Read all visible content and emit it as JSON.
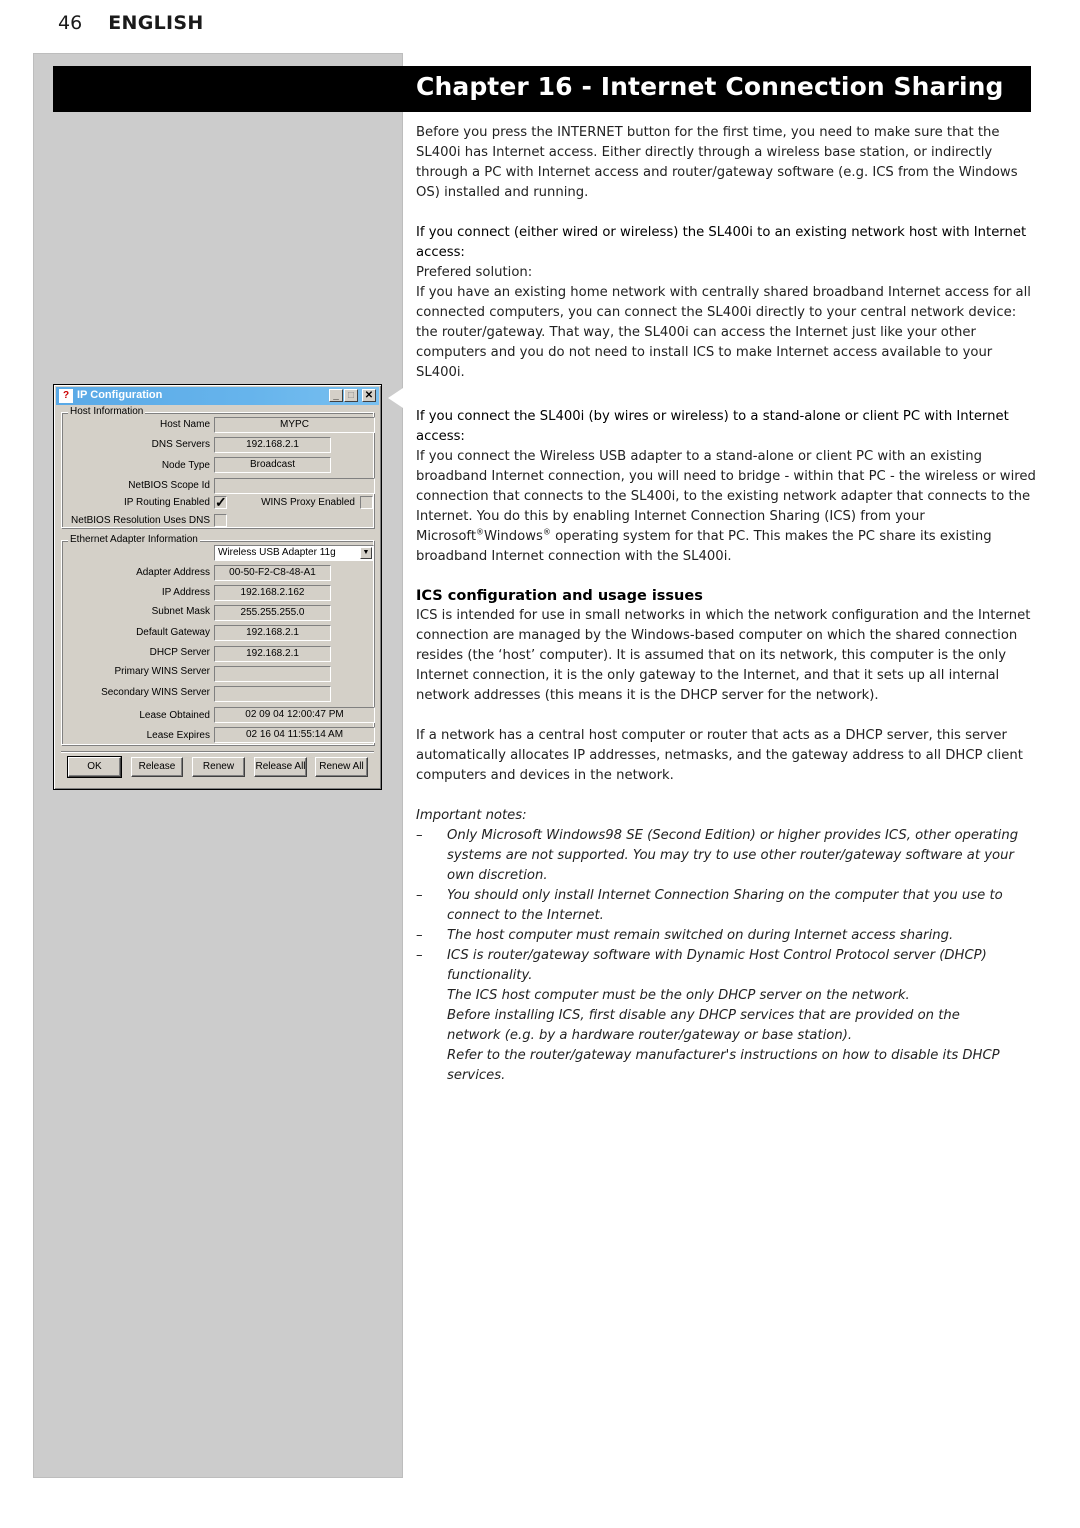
{
  "header": {
    "page_number": "46",
    "language": "ENGLISH"
  },
  "chapter": {
    "title": "Chapter 16 - Internet Connection Sharing"
  },
  "content": {
    "intro": "Before you press the INTERNET button for the first time, you need to make sure that the SL400i has Internet access. Either directly through a wireless base station, or indirectly through a PC with Internet access and router/gateway software (e.g. ICS from the Windows OS) installed and running.",
    "section1": {
      "lead": "If you connect (either wired or wireless) the SL400i to an existing network host with Internet access:",
      "subhead": "Prefered solution:",
      "body": "If you have an existing home network with centrally shared broadband Internet access for all connected computers, you can connect the SL400i directly to your central network device: the router/gateway. That way, the SL400i can access the Internet just like your other computers and you do not need to install ICS to make Internet access available to your SL400i."
    },
    "section2": {
      "lead": "If you connect the SL400i (by wires or wireless) to a stand-alone or client PC with Internet access:",
      "body_part1": "If you connect the Wireless USB adapter to a stand-alone or client PC with an existing broadband Internet connection, you will need to bridge - within that PC - the wireless or wired connection that connects to the SL400i, to the existing network adapter that connects to the Internet. You do this by enabling Internet Connection Sharing (ICS) from your Microsoft",
      "reg1": "®",
      "body_part2": "Windows",
      "reg2": "®",
      "body_part3": " operating system for that PC. This makes the PC share its existing broadband Internet connection with the SL400i."
    },
    "section3": {
      "heading": "ICS configuration and usage issues",
      "body1": "ICS is intended for use in small networks in which the network configuration and the Internet connection are managed by the Windows-based computer on which the shared connection resides (the ‘host’ computer). It is assumed that on its network, this computer is the only Internet connection, it is the only gateway to the Internet, and that it sets up all internal network addresses (this means it is the DHCP server for the network).",
      "body2": "If a network has a central host computer or router that acts as a DHCP server, this server automatically allocates IP addresses, netmasks, and the gateway address to all DHCP client computers and devices in the network."
    },
    "notes": {
      "title": "Important notes:",
      "dash": "–",
      "items": [
        "Only Microsoft Windows98 SE (Second Edition) or higher provides ICS, other operating systems are not supported. You may try to use other router/gateway software at your own discretion.",
        "You should only install Internet Connection Sharing on the computer that you use to connect to the Internet.",
        "The host computer must remain switched on during Internet access sharing.",
        "ICS is router/gateway software with Dynamic Host Control Protocol server (DHCP) functionality."
      ],
      "continuation": [
        "The ICS host computer must be the only DHCP server on the network.",
        "Before installing ICS, first disable any DHCP services that are provided on the network (e.g. by a hardware router/gateway or base station).",
        "Refer to the router/gateway manufacturer's instructions on how to disable its DHCP services."
      ]
    }
  },
  "dialog": {
    "title": "IP Configuration",
    "icon": "ip-config-app-icon",
    "controls": {
      "minimize": "_",
      "maximize": "□",
      "close": "✕"
    },
    "host_group": {
      "label": "Host Information",
      "host_name_label": "Host Name",
      "host_name": "MYPC",
      "dns_label": "DNS Servers",
      "dns": "192.168.2.1",
      "node_type_label": "Node Type",
      "node_type": "Broadcast",
      "scope_label": "NetBIOS Scope Id",
      "scope": "",
      "ip_routing_label": "IP Routing Enabled",
      "ip_routing_checked": true,
      "check_glyph": "✓",
      "wins_proxy_label": "WINS Proxy Enabled",
      "wins_proxy_checked": false,
      "netbios_dns_label": "NetBIOS Resolution Uses DNS",
      "netbios_dns_checked": false
    },
    "eth_group": {
      "label": "Ethernet  Adapter Information",
      "adapter_selected": "Wireless USB Adapter 11g",
      "dropdown_arrow": "▼",
      "adapter_address_label": "Adapter Address",
      "adapter_address": "00-50-F2-C8-48-A1",
      "ip_label": "IP Address",
      "ip": "192.168.2.162",
      "subnet_label": "Subnet Mask",
      "subnet": "255.255.255.0",
      "gateway_label": "Default Gateway",
      "gateway": "192.168.2.1",
      "dhcp_label": "DHCP Server",
      "dhcp": "192.168.2.1",
      "primary_wins_label": "Primary WINS Server",
      "primary_wins": "",
      "secondary_wins_label": "Secondary WINS Server",
      "secondary_wins": "",
      "lease_obtained_label": "Lease Obtained",
      "lease_obtained": "02 09 04 12:00:47 PM",
      "lease_expires_label": "Lease Expires",
      "lease_expires": "02 16 04 11:55:14 AM"
    },
    "buttons": {
      "ok": "OK",
      "release": "Release",
      "renew": "Renew",
      "release_all": "Release All",
      "renew_all": "Renew All"
    }
  }
}
